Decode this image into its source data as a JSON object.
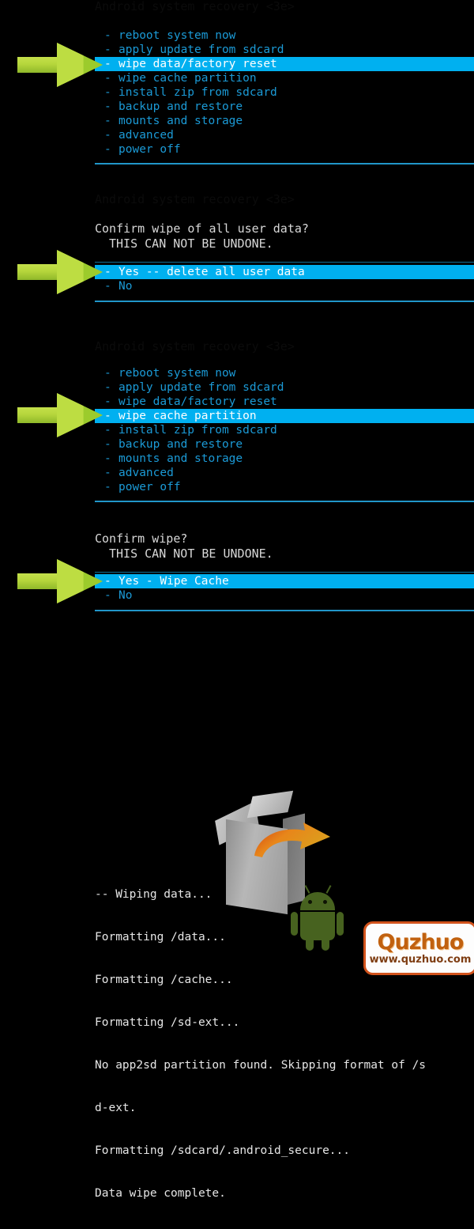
{
  "screen": {
    "background_color": "#000000",
    "menu_text_color": "#1b9ad6",
    "highlight_bg_color": "#00b0f0",
    "highlight_text_color": "#ffffff",
    "rule_color": "#2196c9",
    "console_text_color": "#e6e6e6",
    "arrow_color": "#9ccb2c"
  },
  "ghost_header": "Android system recovery <3e>",
  "sections": [
    {
      "id": "main-menu-wipe-data",
      "items": [
        {
          "label": "reboot system now",
          "selected": false
        },
        {
          "label": "apply update from sdcard",
          "selected": false
        },
        {
          "label": "wipe data/factory reset",
          "selected": true
        },
        {
          "label": "wipe cache partition",
          "selected": false
        },
        {
          "label": "install zip from sdcard",
          "selected": false
        },
        {
          "label": "backup and restore",
          "selected": false
        },
        {
          "label": "mounts and storage",
          "selected": false
        },
        {
          "label": "advanced",
          "selected": false
        },
        {
          "label": "power off",
          "selected": false
        }
      ]
    },
    {
      "id": "confirm-wipe-data",
      "title": "Confirm wipe of all user data?",
      "subtitle": "THIS CAN NOT BE UNDONE.",
      "items": [
        {
          "label": "Yes -- delete all user data",
          "selected": true
        },
        {
          "label": "No",
          "selected": false
        }
      ]
    },
    {
      "id": "main-menu-wipe-cache",
      "items": [
        {
          "label": "reboot system now",
          "selected": false
        },
        {
          "label": "apply update from sdcard",
          "selected": false
        },
        {
          "label": "wipe data/factory reset",
          "selected": false
        },
        {
          "label": "wipe cache partition",
          "selected": true
        },
        {
          "label": "install zip from sdcard",
          "selected": false
        },
        {
          "label": "backup and restore",
          "selected": false
        },
        {
          "label": "mounts and storage",
          "selected": false
        },
        {
          "label": "advanced",
          "selected": false
        },
        {
          "label": "power off",
          "selected": false
        }
      ]
    },
    {
      "id": "confirm-wipe-cache",
      "title": "Confirm wipe?",
      "subtitle": "THIS CAN NOT BE UNDONE.",
      "items": [
        {
          "label": "Yes - Wipe Cache",
          "selected": true
        },
        {
          "label": "No",
          "selected": false
        }
      ]
    }
  ],
  "console": {
    "lines": [
      "-- Wiping data...",
      "Formatting /data...",
      "Formatting /cache...",
      "Formatting /sd-ext...",
      "No app2sd partition found. Skipping format of /s",
      "d-ext.",
      "Formatting /sdcard/.android_secure...",
      "Data wipe complete."
    ]
  },
  "dash": "-",
  "watermark": {
    "brand": "Quzhuo",
    "url": "www.quzhuo.com"
  }
}
